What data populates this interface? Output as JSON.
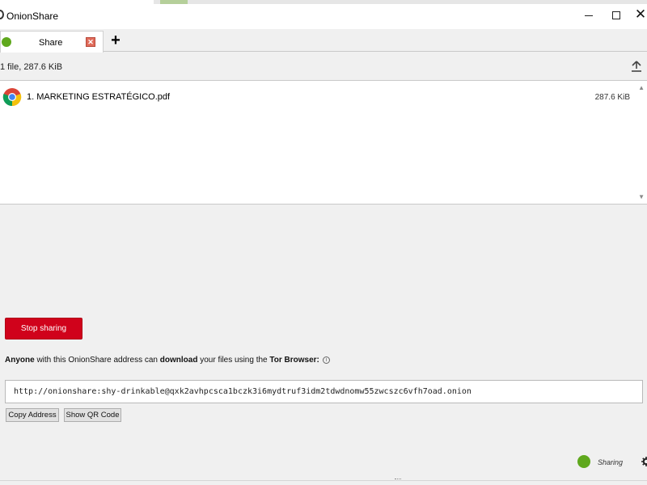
{
  "window": {
    "title": "OnionShare"
  },
  "tabs": [
    {
      "label": "Share",
      "close_symbol": "✕"
    }
  ],
  "tab_add_symbol": "+",
  "file_summary": "1 file, 287.6 KiB",
  "files": [
    {
      "name": "1. MARKETING ESTRATÉGICO.pdf",
      "size": "287.6 KiB",
      "icon": "chrome-icon"
    }
  ],
  "stop_button_label": "Stop sharing",
  "info": {
    "part1": "Anyone",
    "part2": " with this OnionShare address can ",
    "part3": "download",
    "part4": " your files using the ",
    "part5": "Tor Browser:"
  },
  "address": "http://onionshare:shy-drinkable@qxk2avhpcsca1bczk3i6mydtruf3idm2tdwdnomw55zwcszc6vfh7oad.onion",
  "buttons": {
    "copy_address": "Copy Address",
    "show_qr": "Show QR Code"
  },
  "status": {
    "text": "Sharing",
    "color": "#5fa81d"
  },
  "colors": {
    "stop_red": "#d0021b",
    "status_green": "#5fa81d"
  }
}
